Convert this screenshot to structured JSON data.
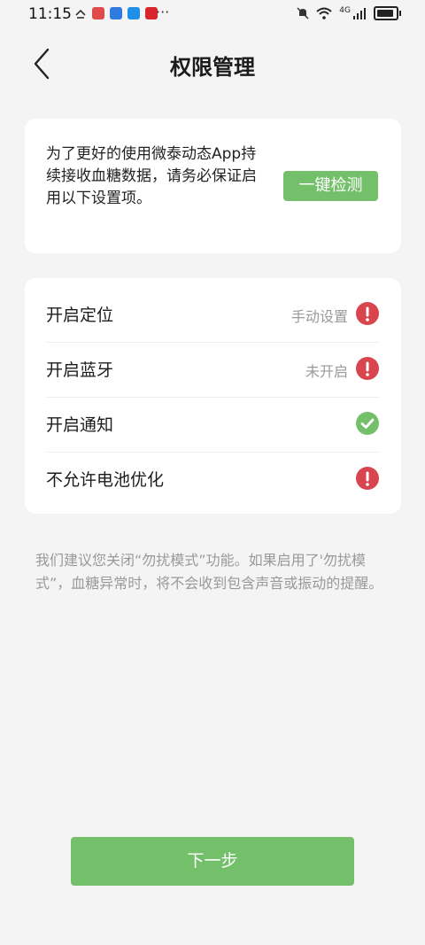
{
  "status_bar": {
    "time": "11:15",
    "more": "···",
    "network": "4G"
  },
  "header": {
    "title": "权限管理",
    "back_icon": "chevron-left-icon"
  },
  "info_card": {
    "text": "为了更好的使用微泰动态App持续接收血糖数据，请务必保证启用以下设置项。",
    "button_label": "一键检测"
  },
  "permissions": [
    {
      "label": "开启定位",
      "status": "手动设置",
      "state": "error"
    },
    {
      "label": "开启蓝牙",
      "status": "未开启",
      "state": "error"
    },
    {
      "label": "开启通知",
      "status": "",
      "state": "ok"
    },
    {
      "label": "不允许电池优化",
      "status": "",
      "state": "error"
    }
  ],
  "notice": "我们建议您关闭“勿扰模式”功能。如果启用了'勿扰模式”，血糖异常时，将不会收到包含声音或振动的提醒。",
  "footer": {
    "next_label": "下一步"
  },
  "colors": {
    "accent_green": "#74c06a",
    "error_red": "#d9454f",
    "ok_green": "#74c06a",
    "background": "#f4f4f4"
  }
}
